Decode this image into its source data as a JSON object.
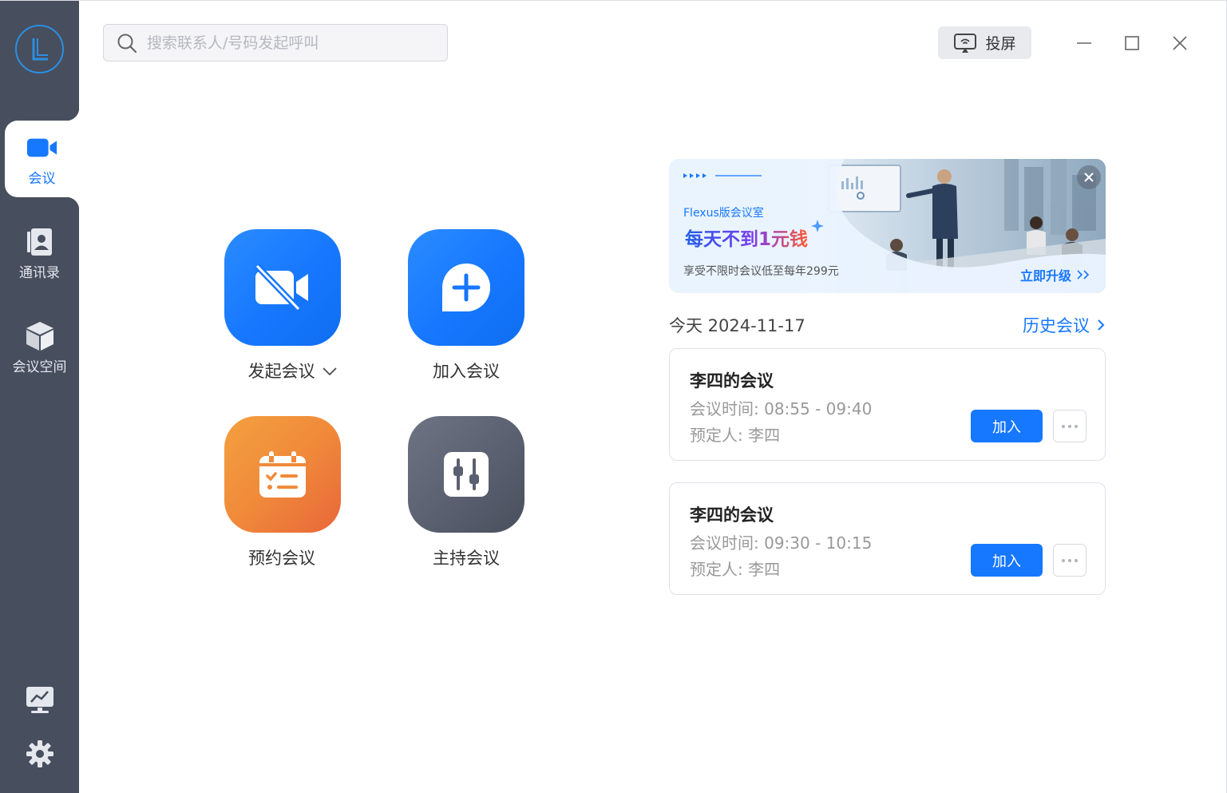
{
  "sidebar": {
    "logo": "L",
    "items": [
      {
        "label": "会议",
        "icon": "video-camera-icon"
      },
      {
        "label": "通讯录",
        "icon": "contacts-icon"
      },
      {
        "label": "会议空间",
        "icon": "cube-icon"
      }
    ],
    "bottom_icons": [
      "monitor-chart-icon",
      "gear-icon"
    ]
  },
  "search": {
    "placeholder": "搜索联系人/号码发起呼叫"
  },
  "header": {
    "cast_label": "投屏"
  },
  "actions": [
    {
      "label": "发起会议",
      "icon": "video-off-icon",
      "color": "#1677ff",
      "has_dropdown": true
    },
    {
      "label": "加入会议",
      "icon": "plus-chat-icon",
      "color": "#1677ff"
    },
    {
      "label": "预约会议",
      "icon": "calendar-icon",
      "color": "#f08a3a"
    },
    {
      "label": "主持会议",
      "icon": "sliders-icon",
      "color": "#5a6070"
    }
  ],
  "banner": {
    "product": "Flexus版会议室",
    "headline": "每天不到1元钱",
    "sub": "享受不限时会议低至每年299元",
    "cta": "立即升级"
  },
  "schedule": {
    "date_label": "今天 2024-11-17",
    "history_label": "历史会议",
    "meetings": [
      {
        "title": "李四的会议",
        "time": "会议时间: 08:55 - 09:40",
        "owner": "预定人: 李四",
        "join_label": "加入"
      },
      {
        "title": "李四的会议",
        "time": "会议时间: 09:30 - 10:15",
        "owner": "预定人: 李四",
        "join_label": "加入"
      }
    ]
  },
  "colors": {
    "accent": "#1677ff",
    "sidebar": "#474e5e"
  }
}
